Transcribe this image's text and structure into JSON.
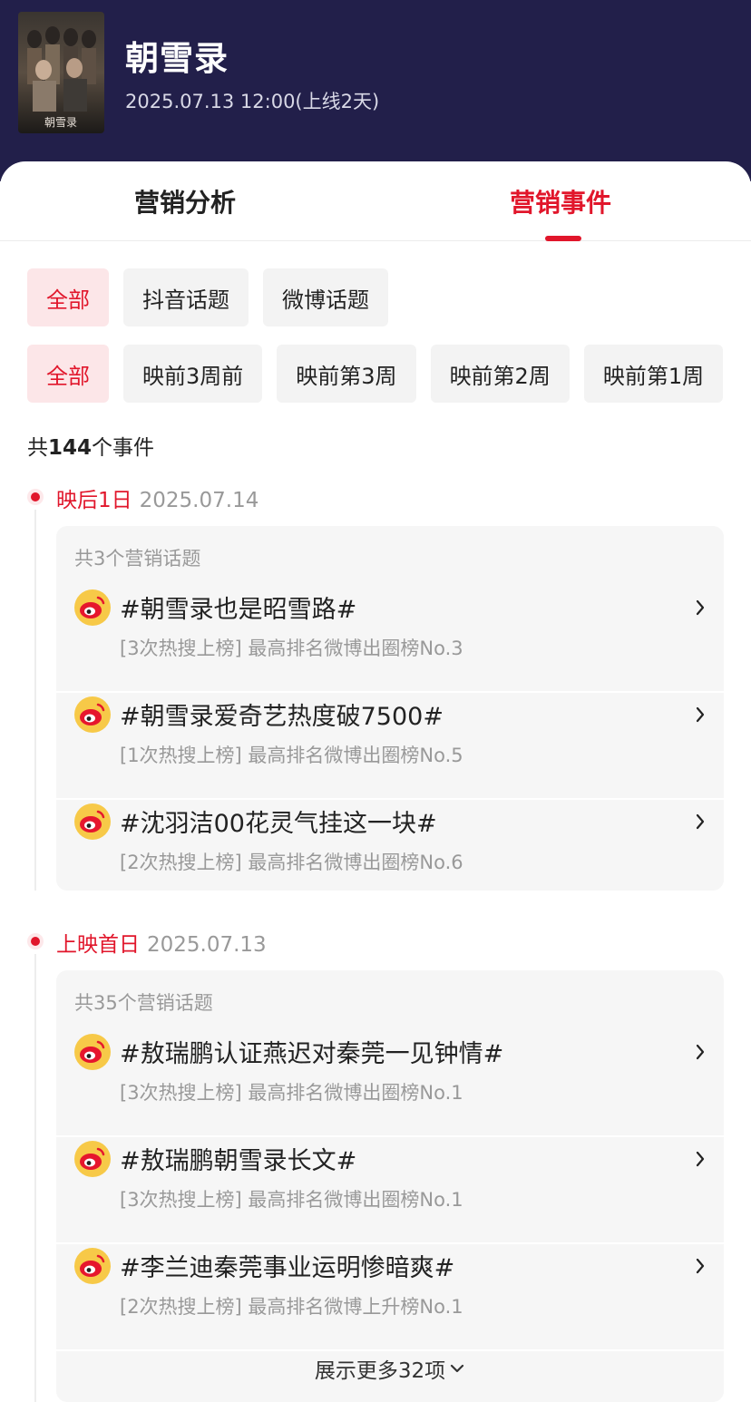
{
  "header": {
    "title": "朝雪录",
    "release": "2025.07.13 12:00(上线2天)"
  },
  "tabs": [
    {
      "label": "营销分析",
      "active": false
    },
    {
      "label": "营销事件",
      "active": true
    }
  ],
  "platform_filters": [
    {
      "label": "全部",
      "active": true
    },
    {
      "label": "抖音话题",
      "active": false
    },
    {
      "label": "微博话题",
      "active": false
    }
  ],
  "period_filters": [
    {
      "label": "全部",
      "active": true
    },
    {
      "label": "映前3周前",
      "active": false
    },
    {
      "label": "映前第3周",
      "active": false
    },
    {
      "label": "映前第2周",
      "active": false
    },
    {
      "label": "映前第1周",
      "active": false
    }
  ],
  "total": {
    "prefix": "共",
    "count": "144",
    "suffix": "个事件"
  },
  "groups": [
    {
      "label": "映后1日",
      "date": "2025.07.14",
      "count_text": "共3个营销话题",
      "items": [
        {
          "title": "#朝雪录也是昭雪路#",
          "sub": "[3次热搜上榜] 最高排名微博出圈榜No.3",
          "icon": "weibo-icon"
        },
        {
          "title": "#朝雪录爱奇艺热度破7500#",
          "sub": "[1次热搜上榜] 最高排名微博出圈榜No.5",
          "icon": "weibo-icon"
        },
        {
          "title": "#沈羽洁00花灵气挂这一块#",
          "sub": "[2次热搜上榜] 最高排名微博出圈榜No.6",
          "icon": "weibo-icon"
        }
      ]
    },
    {
      "label": "上映首日",
      "date": "2025.07.13",
      "count_text": "共35个营销话题",
      "items": [
        {
          "title": "#敖瑞鹏认证燕迟对秦莞一见钟情#",
          "sub": "[3次热搜上榜] 最高排名微博出圈榜No.1",
          "icon": "weibo-icon"
        },
        {
          "title": "#敖瑞鹏朝雪录长文#",
          "sub": "[3次热搜上榜] 最高排名微博出圈榜No.1",
          "icon": "weibo-icon"
        },
        {
          "title": "#李兰迪秦莞事业运明惨暗爽#",
          "sub": "[2次热搜上榜] 最高排名微博上升榜No.1",
          "icon": "weibo-icon"
        }
      ],
      "more_label": "展示更多32项"
    }
  ],
  "colors": {
    "accent": "#e1162b",
    "header_bg": "#221f4a"
  }
}
